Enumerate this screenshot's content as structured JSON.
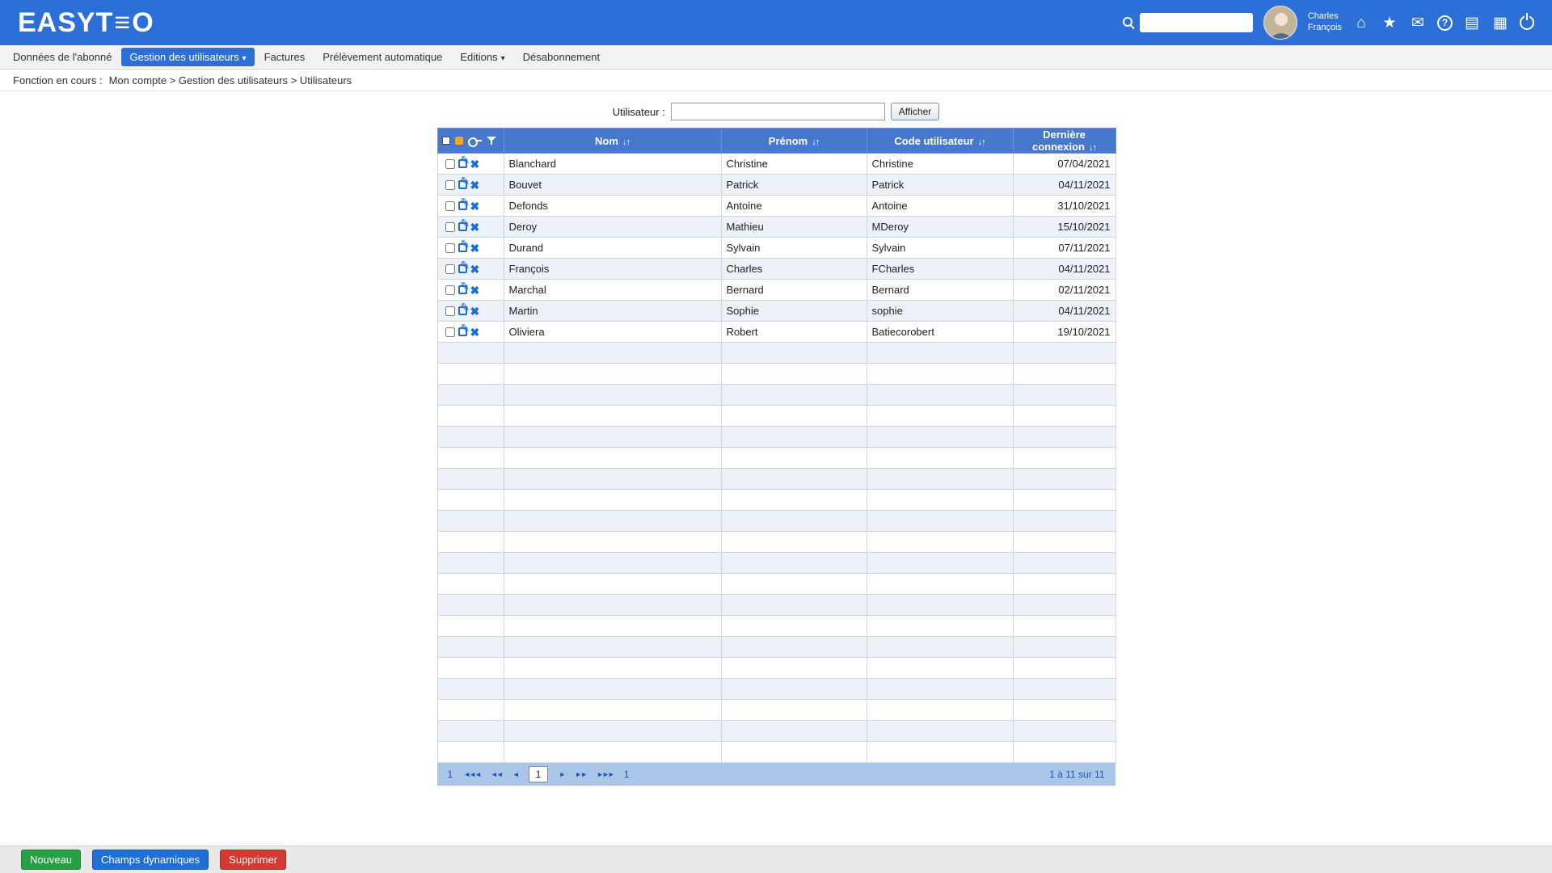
{
  "colors": {
    "topbar_blue": "#2d6fd9",
    "table_header_blue": "#4679ce",
    "accent_blue": "#1b6ed6",
    "row_alt": "#edf1f8",
    "pagination_bg": "#aac6e8",
    "button_green": "#27a045",
    "button_blue": "#1f6fd9",
    "button_red": "#d43a32",
    "orange_square": "#f5a623"
  },
  "icons": {
    "logo_e": "≡",
    "caret_down": "▾",
    "sort": "↓↑",
    "delete": "✖",
    "home": "⌂",
    "star": "★",
    "mail": "✉",
    "help": "?",
    "list": "▤",
    "grid": "▦",
    "pag_first": "◄◄◄",
    "pag_fast_prev": "◄◄",
    "pag_prev": "◄",
    "pag_next": "►",
    "pag_fast_next": "►►",
    "pag_last": "►►►"
  },
  "topbar": {
    "logo_prefix": "EASYT",
    "logo_suffix": "O",
    "search_value": "",
    "user": {
      "name_line1": "Charles",
      "name_line2": "François"
    }
  },
  "menu": {
    "items": [
      {
        "label": "Données de l'abonné"
      },
      {
        "label": "Gestion des utilisateurs"
      },
      {
        "label": "Factures"
      },
      {
        "label": "Prélèvement automatique"
      },
      {
        "label": "Editions"
      },
      {
        "label": "Désabonnement"
      }
    ]
  },
  "breadcrumb": {
    "prefix": "Fonction en cours :",
    "path": "Mon compte > Gestion des utilisateurs > Utilisateurs"
  },
  "filter": {
    "label": "Utilisateur :",
    "value": "",
    "button_label": "Afficher"
  },
  "table": {
    "columns": [
      "Nom",
      "Prénom",
      "Code utilisateur",
      "Dernière connexion"
    ],
    "rows": [
      {
        "nom": "Blanchard",
        "prenom": "Christine",
        "code": "Christine",
        "derniere_connexion": "07/04/2021"
      },
      {
        "nom": "Bouvet",
        "prenom": "Patrick",
        "code": "Patrick",
        "derniere_connexion": "04/11/2021"
      },
      {
        "nom": "Defonds",
        "prenom": "Antoine",
        "code": "Antoine",
        "derniere_connexion": "31/10/2021"
      },
      {
        "nom": "Deroy",
        "prenom": "Mathieu",
        "code": "MDeroy",
        "derniere_connexion": "15/10/2021"
      },
      {
        "nom": "Durand",
        "prenom": "Sylvain",
        "code": "Sylvain",
        "derniere_connexion": "07/11/2021"
      },
      {
        "nom": "François",
        "prenom": "Charles",
        "code": "FCharles",
        "derniere_connexion": "04/11/2021"
      },
      {
        "nom": "Marchal",
        "prenom": "Bernard",
        "code": "Bernard",
        "derniere_connexion": "02/11/2021"
      },
      {
        "nom": "Martin",
        "prenom": "Sophie",
        "code": "sophie",
        "derniere_connexion": "04/11/2021"
      },
      {
        "nom": "Oliviera",
        "prenom": "Robert",
        "code": "Batiecorobert",
        "derniere_connexion": "19/10/2021"
      }
    ],
    "empty_row_count": 20,
    "pagination": {
      "first_label": "1",
      "current_page": "1",
      "last_label": "1",
      "summary": "1 à 11 sur 11"
    }
  },
  "footer": {
    "buttons": [
      {
        "label": "Nouveau"
      },
      {
        "label": "Champs dynamiques"
      },
      {
        "label": "Supprimer"
      }
    ]
  }
}
